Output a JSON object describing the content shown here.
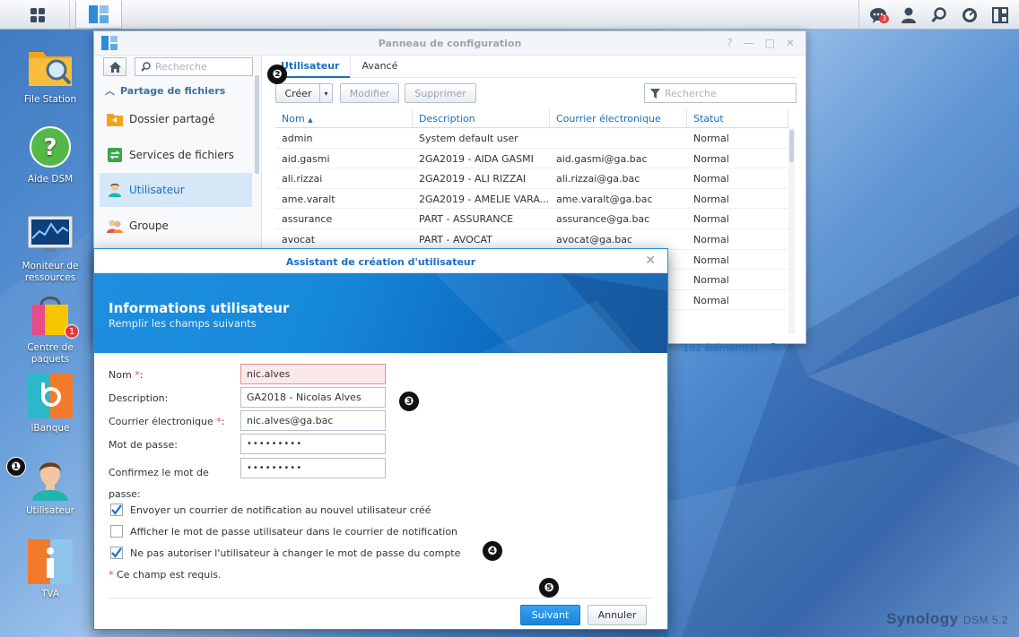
{
  "taskbar": {
    "notifications_count": "3",
    "icons": [
      "main-menu-icon",
      "control-panel-icon",
      "notifications-icon",
      "user-icon",
      "search-icon",
      "resource-widget-icon",
      "widgets-icon"
    ]
  },
  "desktop": {
    "icons": [
      {
        "label": "File Station"
      },
      {
        "label": "Aide DSM"
      },
      {
        "label": "Moniteur de ressources"
      },
      {
        "label": "Centre de paquets",
        "badge": "1"
      },
      {
        "label": "iBanque"
      },
      {
        "label": "Utilisateur"
      },
      {
        "label": "TVA"
      }
    ],
    "markers": [
      "❶",
      "❷",
      "❸",
      "❹",
      "❺"
    ]
  },
  "control_panel": {
    "title": "Panneau de configuration",
    "search_placeholder": "Recherche",
    "section": "Partage de fichiers",
    "nav": [
      {
        "label": "Dossier partagé"
      },
      {
        "label": "Services de fichiers"
      },
      {
        "label": "Utilisateur"
      },
      {
        "label": "Groupe"
      }
    ],
    "tabs": [
      "Utilisateur",
      "Avancé"
    ],
    "toolbar": {
      "create": "Créer",
      "modify": "Modifier",
      "delete": "Supprimer",
      "filter_placeholder": "Recherche"
    },
    "columns": [
      "Nom",
      "Description",
      "Courrier électronique",
      "Statut"
    ],
    "rows": [
      [
        "admin",
        "System default user",
        "",
        "Normal"
      ],
      [
        "aid.gasmi",
        "2GA2019 - AIDA GASMI",
        "aid.gasmi@ga.bac",
        "Normal"
      ],
      [
        "ali.rizzai",
        "2GA2019 - ALI RIZZAI",
        "ali.rizzai@ga.bac",
        "Normal"
      ],
      [
        "ame.varalt",
        "2GA2019 - AMELIE VARA...",
        "ame.varalt@ga.bac",
        "Normal"
      ],
      [
        "assurance",
        "PART - ASSURANCE",
        "assurance@ga.bac",
        "Normal"
      ],
      [
        "avocat",
        "PART - AVOCAT",
        "avocat@ga.bac",
        "Normal"
      ],
      [
        "",
        "",
        "",
        "Normal"
      ],
      [
        "",
        "",
        "",
        "Normal"
      ],
      [
        "",
        "",
        "",
        "Normal"
      ]
    ],
    "status": "192 élément(s)"
  },
  "wizard": {
    "title": "Assistant de création d'utilisateur",
    "heading": "Informations utilisateur",
    "subheading": "Remplir les champs suivants",
    "fields": {
      "name_label": "Nom",
      "name_value": "nic.alves",
      "description_label": "Description:",
      "description_value": "GA2018 - Nicolas Alves",
      "email_label": "Courrier électronique",
      "email_value": "nic.alves@ga.bac",
      "password_label": "Mot de passe:",
      "password_value": "•••••••••",
      "confirm_label_1": "Confirmez le mot de",
      "confirm_label_2": "passe:",
      "confirm_value": "•••••••••",
      "required_mark": "*",
      "colon": ":"
    },
    "checkboxes": [
      {
        "label": "Envoyer un courrier de notification au nouvel utilisateur créé",
        "checked": true
      },
      {
        "label": "Afficher le mot de passe utilisateur dans le courrier de notification",
        "checked": false
      },
      {
        "label": "Ne pas autoriser l'utilisateur à changer le mot de passe du compte",
        "checked": true
      }
    ],
    "note_mark": "*",
    "note": "Ce champ est requis.",
    "next": "Suivant",
    "cancel": "Annuler"
  },
  "brand": {
    "name": "Synology",
    "product": "DSM 5.2"
  }
}
